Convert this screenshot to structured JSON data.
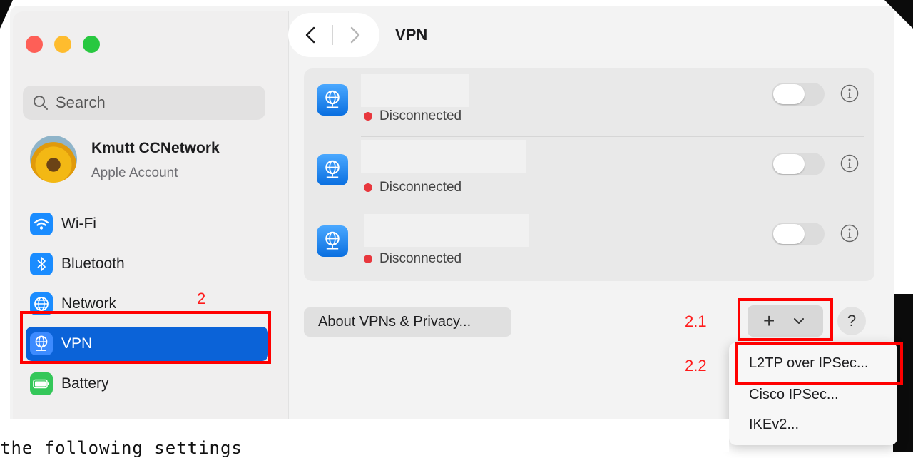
{
  "window": {
    "title": "VPN"
  },
  "search": {
    "placeholder": "Search"
  },
  "account": {
    "name": "Kmutt CCNetwork",
    "subtitle": "Apple Account"
  },
  "sidebar": {
    "items": [
      {
        "label": "Wi-Fi",
        "icon": "wifi-icon",
        "color": "#1a8cff"
      },
      {
        "label": "Bluetooth",
        "icon": "bluetooth-icon",
        "color": "#1a8cff"
      },
      {
        "label": "Network",
        "icon": "globe-icon",
        "color": "#1a8cff"
      },
      {
        "label": "VPN",
        "icon": "vpn-globe-icon",
        "color": "#1a8cff",
        "selected": true
      },
      {
        "label": "Battery",
        "icon": "battery-icon",
        "color": "#34c759"
      }
    ]
  },
  "vpn_list": {
    "connections": [
      {
        "name": "",
        "status": "Disconnected",
        "enabled": false
      },
      {
        "name": "",
        "status": "Disconnected",
        "enabled": false
      },
      {
        "name": "",
        "status": "Disconnected",
        "enabled": false
      }
    ]
  },
  "actions": {
    "about_label": "About VPNs & Privacy...",
    "add_symbol": "+",
    "help_symbol": "?"
  },
  "add_menu": {
    "items": [
      "L2TP over IPSec...",
      "Cisco IPSec...",
      "IKEv2..."
    ]
  },
  "annotations": {
    "step_2": "2",
    "step_2_1": "2.1",
    "step_2_2": "2.2",
    "highlight_color": "#ff0000"
  },
  "caption": {
    "text": "the following settings"
  },
  "colors": {
    "accent": "#0b63d8",
    "disconnected": "#e8373d"
  }
}
